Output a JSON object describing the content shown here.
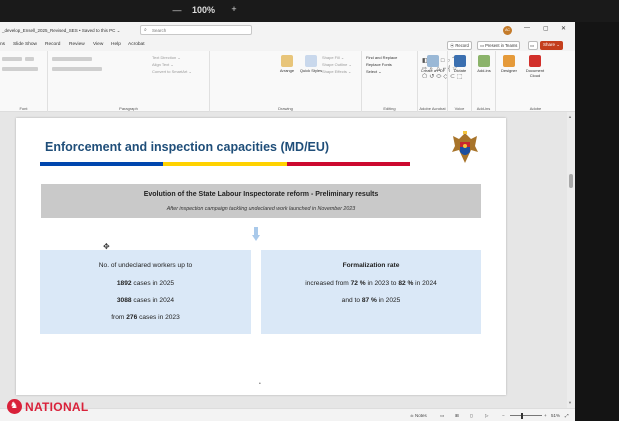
{
  "screen": {
    "zoom_minus": "—",
    "zoom_level": "100%",
    "zoom_plus": "+"
  },
  "window": {
    "title": "_develop_Ensell_2025_Revised_SES • Saved to this PC ⌄",
    "search_placeholder": "Search",
    "avatar_initials": "AC",
    "minimize": "—",
    "restore": "▢",
    "close": "✕"
  },
  "menu": {
    "items": [
      "ns",
      "Slide Show",
      "Record",
      "Review",
      "View",
      "Help",
      "Acrobat"
    ],
    "record_btn": "⦿ Record",
    "present_btn": "▭ Present in Teams",
    "share_btn": "Share ⌄",
    "comment_icon": "comment-icon"
  },
  "ribbon": {
    "groups": [
      "Font",
      "Paragraph",
      "Drawing",
      "Editing",
      "Adobe Acrobat",
      "Voice",
      "Add-ins",
      "Adobe"
    ],
    "paragraph_items": [
      "Text Direction ⌄",
      "Align Text ⌄",
      "Convert to SmartArt ⌄"
    ],
    "drawing_items": [
      "Shape Fill ⌄",
      "Shape Outline ⌄",
      "Shape Effects ⌄"
    ],
    "arrange_label": "Arrange",
    "quick_styles_label": "Quick Styles",
    "editing_items": [
      "Find and Replace",
      "Replace Fonts",
      "Select ⌄"
    ],
    "buttons": [
      "Create a PDF",
      "Dictate",
      "Add-ins",
      "Designer",
      "Document Cloud"
    ]
  },
  "slide": {
    "title": "Enforcement and inspection capacities (MD/EU)",
    "flag_colors": [
      "#0046ae",
      "#ffd200",
      "#cc092f"
    ],
    "band": {
      "title": "Evolution of the State Labour Inspectorate reform - Preliminary results",
      "subtitle": "After inspection campaign tackling undeclared work launched in November 2023"
    },
    "left_box": {
      "line1": "No. of undeclared workers up to",
      "l2_num": "1892",
      "l2_text": " cases in 2025",
      "l3_num": "3088",
      "l3_text": " cases in 2024",
      "l4_pre": "from ",
      "l4_num": "276",
      "l4_text": " cases in 2023"
    },
    "right_box": {
      "title": "Formalization rate",
      "l2_pre": "increased from ",
      "l2_num1": "72 %",
      "l2_mid": " in 2023 to  ",
      "l2_num2": "82 %",
      "l2_post": " in 2024",
      "l3_pre": "and to ",
      "l3_num": "87 %",
      "l3_post": " in 2025"
    },
    "page_marker": "•"
  },
  "status": {
    "notes": "≐ Notes",
    "zoom": "51%",
    "fit": "⤢"
  },
  "watermark": {
    "logo_text": "NATIONAL"
  }
}
